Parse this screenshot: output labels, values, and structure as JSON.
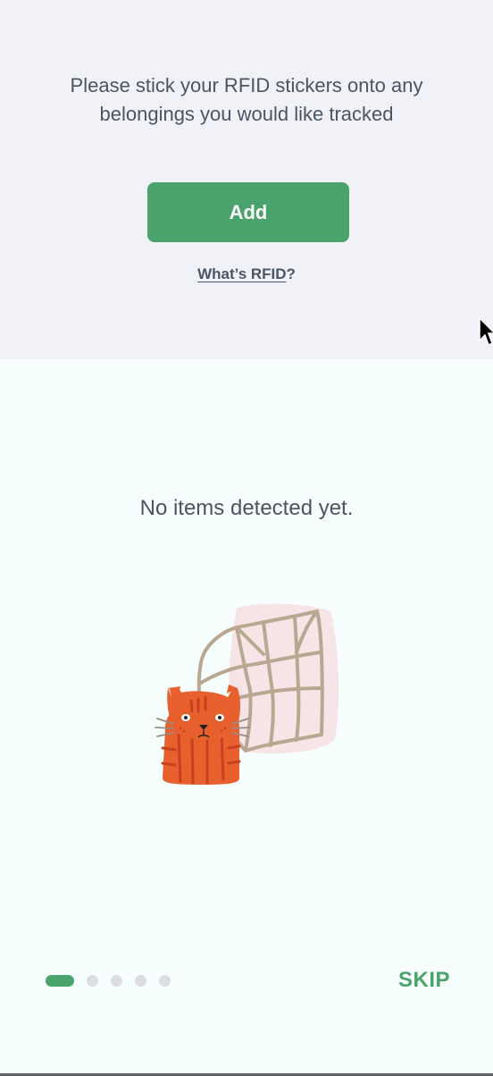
{
  "setup": {
    "instructions": "Please stick your RFID stickers onto any belongings you would like tracked",
    "add_label": "Add",
    "rfid_link_text": "What’s RFID",
    "rfid_link_suffix": "?"
  },
  "detection": {
    "empty_message": "No items detected yet."
  },
  "onboarding": {
    "page_count": 5,
    "current_page": 1,
    "skip_label": "SKIP"
  },
  "colors": {
    "accent": "#4aa36a",
    "text": "#4a5563",
    "top_background": "#f1f2f7",
    "bottom_background": "#f6fffd"
  },
  "icons": {
    "illustration": "cat-and-net-illustration",
    "cursor": "mouse-pointer-icon"
  }
}
